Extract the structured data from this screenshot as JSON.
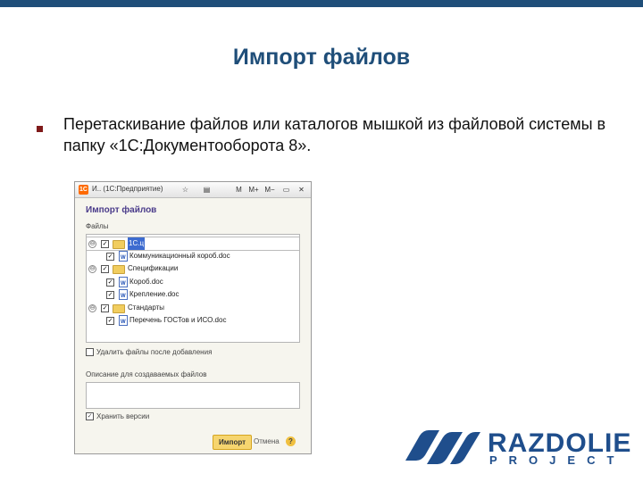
{
  "slide": {
    "title": "Импорт файлов",
    "bullet_text": "Перетаскивание файлов или каталогов мышкой из файловой системы в папку «1С:Документооборота 8»."
  },
  "window": {
    "caption": "И.. (1С:Предприятие)",
    "toolbar": [
      "☆",
      "▤",
      "M",
      "M+",
      "M−",
      "▭",
      "✕"
    ],
    "panel_title": "Импорт файлов",
    "files_label": "Файлы",
    "tree": [
      {
        "level": 0,
        "type": "folder",
        "text": "1С.ц",
        "expand": "⊖",
        "checked": true,
        "selected": true
      },
      {
        "level": 1,
        "type": "file",
        "text": "Коммуникационный короб.doc",
        "checked": true
      },
      {
        "level": 0,
        "type": "folder",
        "text": "Спецификации",
        "expand": "⊖",
        "checked": true
      },
      {
        "level": 1,
        "type": "file",
        "text": "Короб.doc",
        "checked": true
      },
      {
        "level": 1,
        "type": "file",
        "text": "Крепление.doc",
        "checked": true
      },
      {
        "level": 0,
        "type": "folder",
        "text": "Стандарты",
        "expand": "⊖",
        "checked": true
      },
      {
        "level": 1,
        "type": "file",
        "text": "Перечень ГОСТов и ИСО.doc",
        "checked": true
      }
    ],
    "delete_files_label": "Удалить файлы после добавления",
    "delete_files_checked": false,
    "description_label": "Описание для создаваемых файлов",
    "description_value": "",
    "keep_versions_label": "Хранить версии",
    "keep_versions_checked": true,
    "import_button": "Импорт",
    "cancel_button": "Отмена",
    "help": "?"
  },
  "logo": {
    "name": "RAZDOLIE",
    "sub": "PROJECT",
    "color": "#1f4e8c"
  },
  "colors": {
    "title": "#1f4e79",
    "bullet": "#7f1a1a",
    "selection": "#3d6bd0"
  }
}
